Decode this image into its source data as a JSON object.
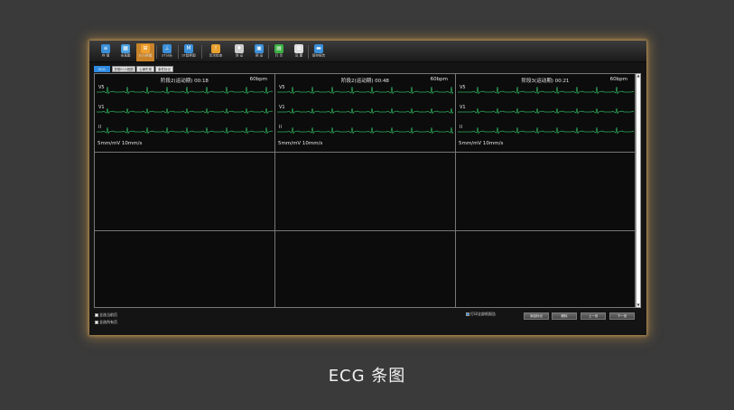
{
  "toolbar": {
    "buttons": [
      {
        "label": "存 储",
        "icon": "save-disk-icon",
        "color": "#3a8fd8",
        "glyph": "≡"
      },
      {
        "label": "全息图",
        "icon": "hologram-icon",
        "color": "#4aa0e0",
        "glyph": "▦"
      },
      {
        "label": "ECG条图",
        "icon": "ecg-strip-icon",
        "color": "#f0a030",
        "glyph": "⊞",
        "active": true
      },
      {
        "label": "ST分析",
        "icon": "st-analysis-icon",
        "color": "#3a8fd8",
        "glyph": "⊥"
      },
      {
        "label": "ST趋势图",
        "icon": "st-trend-icon",
        "color": "#3a8fd8",
        "glyph": "M"
      },
      {
        "label": "历次检查",
        "icon": "history-icon",
        "color": "#e8a030",
        "glyph": "!"
      },
      {
        "label": "体 征",
        "icon": "vitals-icon",
        "color": "#cccccc",
        "glyph": "♦"
      },
      {
        "label": "预 览",
        "icon": "preview-icon",
        "color": "#3a8fd8",
        "glyph": "▣"
      },
      {
        "label": "打 印",
        "icon": "print-icon",
        "color": "#3cb043",
        "glyph": "▤"
      },
      {
        "label": "设 置",
        "icon": "settings-gear-icon",
        "color": "#dddddd",
        "glyph": "✿"
      },
      {
        "label": "保存报告",
        "icon": "save-report-icon",
        "color": "#3a8fd8",
        "glyph": "▬"
      }
    ]
  },
  "tabs": [
    {
      "label": "ECG",
      "active": true
    },
    {
      "label": "异常ECG视图",
      "active": false
    },
    {
      "label": "心律失常",
      "active": false
    },
    {
      "label": "事件标记",
      "active": false
    }
  ],
  "strips": [
    {
      "title": "阶段2(运动期) 00:18",
      "bpm": "60bpm",
      "leads": [
        "V5",
        "V1",
        "II"
      ],
      "scale": "5mm/mV 10mm/s"
    },
    {
      "title": "阶段2(运动期) 00:48",
      "bpm": "60bpm",
      "leads": [
        "V5",
        "V1",
        "II"
      ],
      "scale": "5mm/mV 10mm/s"
    },
    {
      "title": "阶段3(运动期) 00:21",
      "bpm": "60bpm",
      "leads": [
        "V5",
        "V1",
        "II"
      ],
      "scale": "5mm/mV 10mm/s"
    }
  ],
  "bottom": {
    "check_left_1": "全选当前页",
    "check_left_2": "全选所有页",
    "check_right": "打印全部纸报告",
    "buttons": [
      "添加标记",
      "删除",
      "上一页",
      "下一页"
    ]
  },
  "caption": "ECG 条图",
  "colors": {
    "ecg_trace": "#2fae5c",
    "accent": "#c8832a",
    "tab_active": "#2d8ae0"
  }
}
